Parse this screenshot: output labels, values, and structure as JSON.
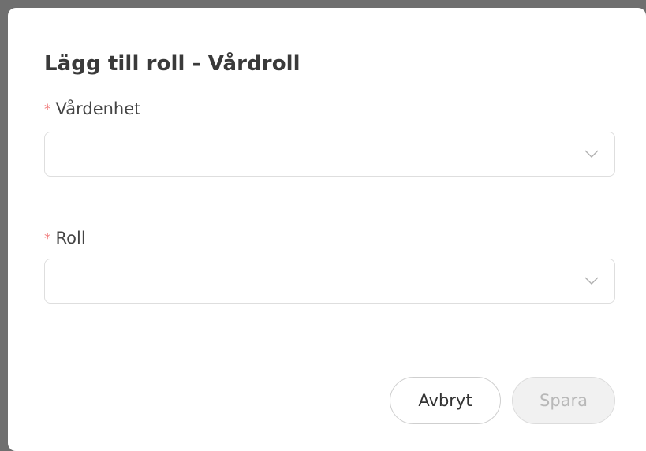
{
  "dialog": {
    "title": "Lägg till roll - Vårdroll",
    "fields": {
      "unit": {
        "required_marker": "*",
        "label": "Vårdenhet",
        "value": ""
      },
      "role": {
        "required_marker": "*",
        "label": "Roll",
        "value": ""
      }
    },
    "buttons": {
      "cancel_label": "Avbryt",
      "save_label": "Spara",
      "save_disabled": true
    }
  },
  "colors": {
    "required": "#f07a7a",
    "title": "#3a3a3a",
    "border": "#dedede",
    "disabled_text": "#b8b8b8"
  },
  "icons": {
    "select_chevron": "chevron-down-icon"
  }
}
